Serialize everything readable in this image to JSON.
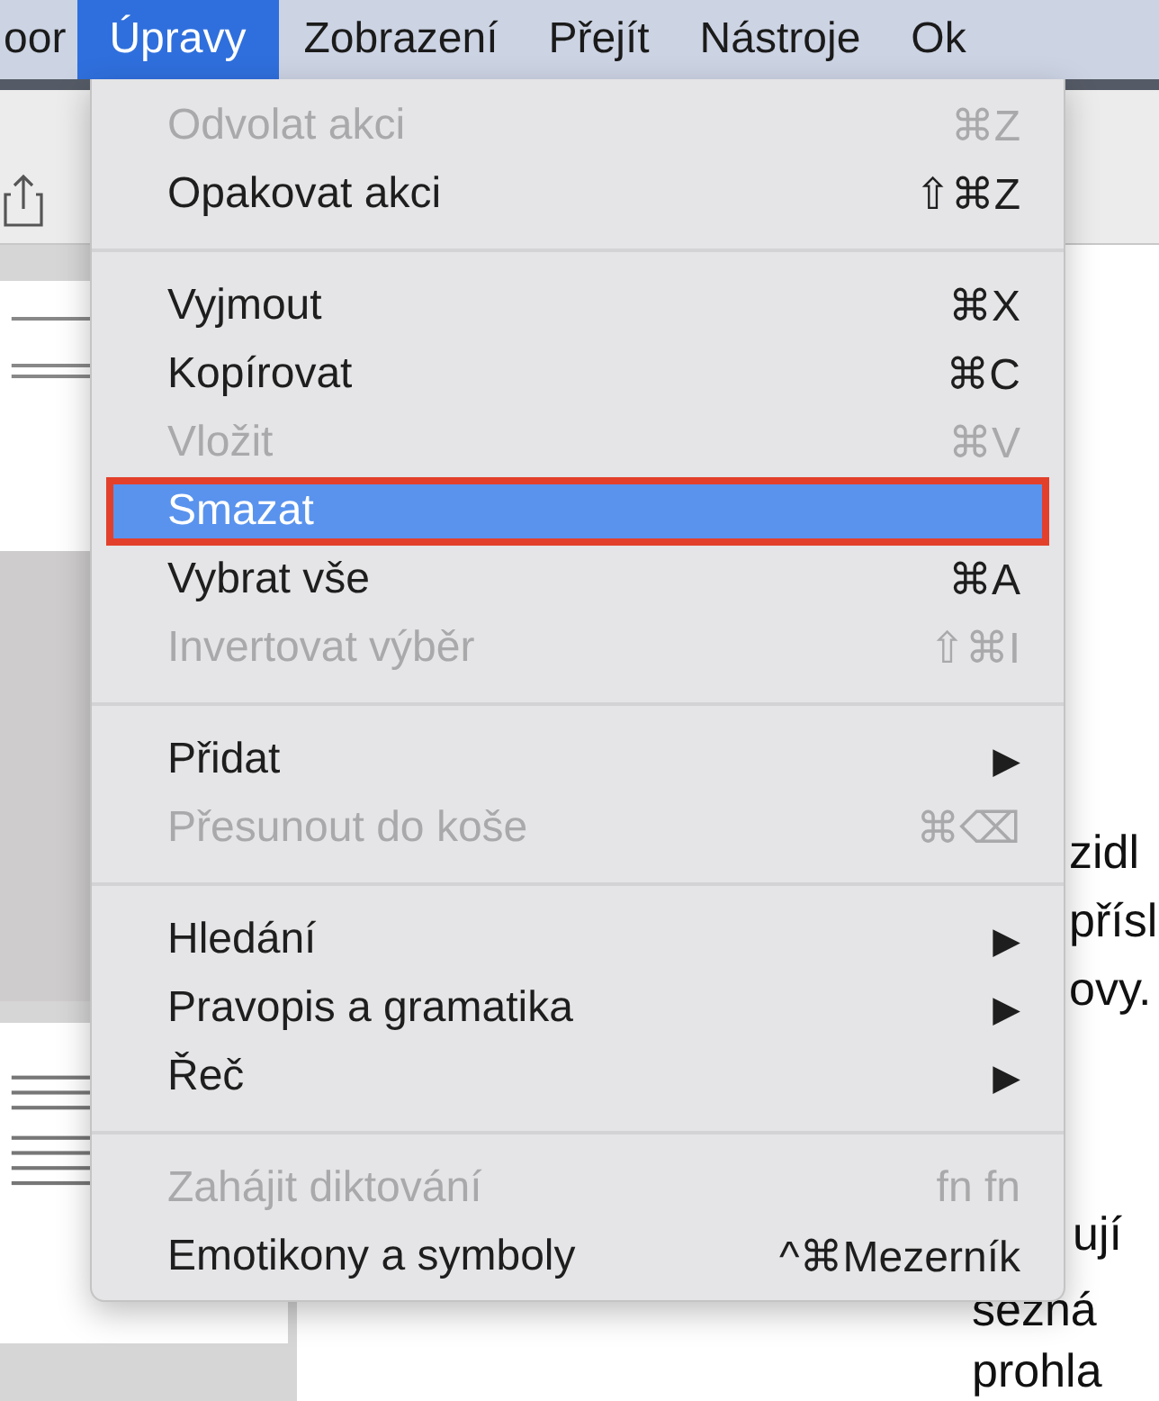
{
  "menu_bar": [
    {
      "label": "oor",
      "selected": false
    },
    {
      "label": "Úpravy",
      "selected": true
    },
    {
      "label": "Zobrazení",
      "selected": false
    },
    {
      "label": "Přejít",
      "selected": false
    },
    {
      "label": "Nástroje",
      "selected": false
    },
    {
      "label": "Ok",
      "selected": false
    }
  ],
  "menu": {
    "sections": [
      [
        {
          "kind": "item",
          "label": "Odvolat akci",
          "shortcut": "⌘Z",
          "disabled": true,
          "selected": false
        },
        {
          "kind": "item",
          "label": "Opakovat akci",
          "shortcut": "⇧⌘Z",
          "disabled": false,
          "selected": false
        }
      ],
      [
        {
          "kind": "item",
          "label": "Vyjmout",
          "shortcut": "⌘X",
          "disabled": false,
          "selected": false
        },
        {
          "kind": "item",
          "label": "Kopírovat",
          "shortcut": "⌘C",
          "disabled": false,
          "selected": false
        },
        {
          "kind": "item",
          "label": "Vložit",
          "shortcut": "⌘V",
          "disabled": true,
          "selected": false
        },
        {
          "kind": "item",
          "label": "Smazat",
          "disabled": false,
          "selected": true,
          "callout": true
        },
        {
          "kind": "item",
          "label": "Vybrat vše",
          "shortcut": "⌘A",
          "disabled": false,
          "selected": false
        },
        {
          "kind": "item",
          "label": "Invertovat výběr",
          "shortcut": "⇧⌘I",
          "disabled": true,
          "selected": false
        }
      ],
      [
        {
          "kind": "submenu",
          "label": "Přidat",
          "arrow": "▶",
          "disabled": false,
          "selected": false
        },
        {
          "kind": "item",
          "label": "Přesunout do koše",
          "shortcut": "⌘⌫",
          "disabled": true,
          "selected": false
        }
      ],
      [
        {
          "kind": "submenu",
          "label": "Hledání",
          "arrow": "▶",
          "disabled": false,
          "selected": false
        },
        {
          "kind": "submenu",
          "label": "Pravopis a gramatika",
          "arrow": "▶",
          "disabled": false,
          "selected": false
        },
        {
          "kind": "submenu",
          "label": "Řeč",
          "arrow": "▶",
          "disabled": false,
          "selected": false
        }
      ],
      [
        {
          "kind": "item",
          "label": "Zahájit diktování",
          "shortcut": "fn fn",
          "disabled": true,
          "selected": false
        },
        {
          "kind": "item",
          "label": "Emotikony a symboly",
          "shortcut": "^⌘Mezerník",
          "disabled": false,
          "selected": false
        }
      ]
    ]
  },
  "document": {
    "lines_upper": [
      "zidl",
      "přísl",
      "ovy."
    ],
    "lines_lower": [
      "ují"
    ],
    "lines_bottom": [
      "sezná",
      "prohla"
    ]
  }
}
